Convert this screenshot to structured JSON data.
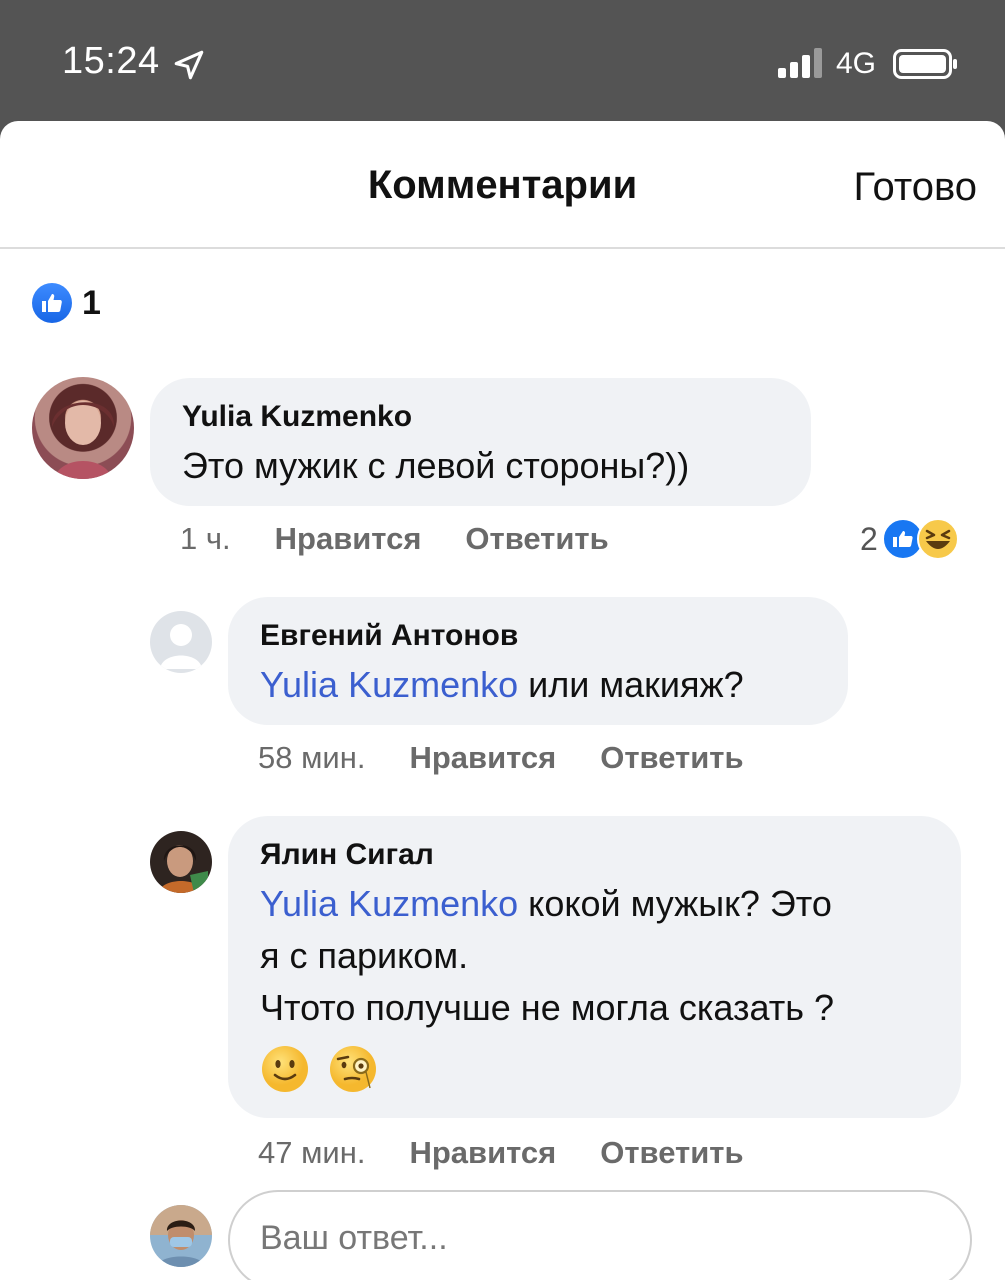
{
  "status_bar": {
    "time": "15:24",
    "network": "4G",
    "icons": [
      "location-arrow-icon",
      "signal-icon",
      "battery-icon"
    ]
  },
  "header": {
    "title": "Комментарии",
    "done_label": "Готово"
  },
  "post_likes": {
    "icon": "like-icon",
    "count": "1"
  },
  "comments": [
    {
      "author": "Yulia Kuzmenko",
      "text": "Это мужик с левой стороны?))",
      "time": "1 ч.",
      "like_label": "Нравится",
      "reply_label": "Ответить",
      "reactions": {
        "count": "2",
        "icons": [
          "like-icon",
          "haha-icon"
        ]
      }
    }
  ],
  "replies": [
    {
      "author": "Евгений Антонов",
      "mention": "Yulia Kuzmenko",
      "text": " или макияж?",
      "time": "58 мин.",
      "like_label": "Нравится",
      "reply_label": "Ответить"
    },
    {
      "author": "Ялин Сигал",
      "mention": "Yulia Kuzmenko",
      "text_line1": " кокой мужык? Это",
      "text_line2": "я с париком.",
      "text_line3": "Чтото получше не могла сказать ?",
      "emojis": [
        "slight-smile-emoji",
        "monocle-emoji"
      ],
      "time": "47 мин.",
      "like_label": "Нравится",
      "reply_label": "Ответить"
    }
  ],
  "reply_box": {
    "placeholder": "Ваш ответ..."
  },
  "colors": {
    "status_bar_bg": "#545454",
    "bubble_bg": "#f0f2f5",
    "mention": "#3b5fcf",
    "like_blue": "#1877f2"
  }
}
